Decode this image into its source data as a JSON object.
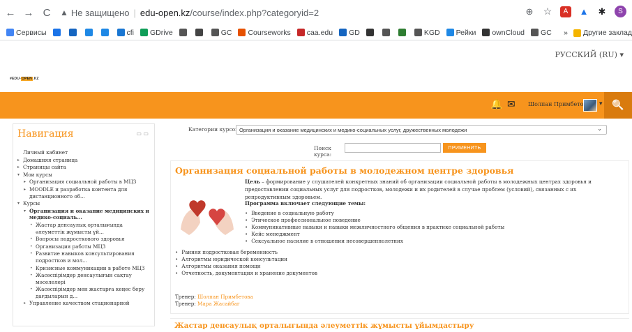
{
  "browser": {
    "back": "←",
    "forward": "→",
    "reload": "C",
    "warning_icon": "▲",
    "not_secure": "Не защищено",
    "url_domain": "edu-open.kz",
    "url_path": "/course/index.php?categoryid=2",
    "extensions": [
      "zoom-icon",
      "star-icon",
      "adobe-icon",
      "drive-icon",
      "puzzle-icon",
      "profile-avatar"
    ],
    "profile_letter": "S"
  },
  "bookmarks": {
    "items": [
      {
        "label": "Сервисы",
        "color": "#4285f4"
      },
      {
        "label": "",
        "color": "#1a73e8"
      },
      {
        "label": "",
        "color": "#1565c0"
      },
      {
        "label": "",
        "color": "#1e88e5"
      },
      {
        "label": "",
        "color": "#1e88e5"
      },
      {
        "label": "cfi",
        "color": "#1976d2"
      },
      {
        "label": "GDrive",
        "color": "#0f9d58"
      },
      {
        "label": "",
        "color": "#555555"
      },
      {
        "label": "",
        "color": "#444444"
      },
      {
        "label": "GC",
        "color": "#555555"
      },
      {
        "label": "Courseworks",
        "color": "#e65100"
      },
      {
        "label": "caa.edu",
        "color": "#c62828"
      },
      {
        "label": "GD",
        "color": "#1565c0"
      },
      {
        "label": "",
        "color": "#333333"
      },
      {
        "label": "",
        "color": "#555555"
      },
      {
        "label": "",
        "color": "#2e7d32"
      },
      {
        "label": "KGD",
        "color": "#555555"
      },
      {
        "label": "Рейки",
        "color": "#1e88e5"
      },
      {
        "label": "ownCloud",
        "color": "#333333"
      },
      {
        "label": "GC",
        "color": "#555555"
      }
    ],
    "more": "»",
    "other": "Другие заклад"
  },
  "header": {
    "language": "РУССКИЙ (RU) ▾",
    "logo_prefix": "#EDU-",
    "logo_highlight": "OPEN",
    "logo_suffix": ".KZ"
  },
  "topbar": {
    "bell_icon": "🔔",
    "mail_icon": "✉",
    "user_name": "Шолпан Примбетова",
    "caret": "▾",
    "search_icon": "🔍"
  },
  "navigation": {
    "title": "Навигация",
    "title_icons": "▭ ▭",
    "items": [
      {
        "marker": "",
        "indent": 1,
        "bold": false,
        "label": "Личный кабинет"
      },
      {
        "marker": "▸",
        "indent": 1,
        "bold": false,
        "label": "Домашняя страница"
      },
      {
        "marker": "▸",
        "indent": 1,
        "bold": false,
        "label": "Страницы сайта"
      },
      {
        "marker": "▾",
        "indent": 1,
        "bold": false,
        "label": "Мои курсы"
      },
      {
        "marker": "▸",
        "indent": 2,
        "bold": false,
        "label": "Организация социальной работы в МЦЗ"
      },
      {
        "marker": "▸",
        "indent": 2,
        "bold": false,
        "label": "MOODLE и разработка контента для дистанционного об..."
      },
      {
        "marker": "▾",
        "indent": 1,
        "bold": false,
        "label": "Курсы"
      },
      {
        "marker": "▾",
        "indent": 2,
        "bold": true,
        "label": "Организация и оказание медицинских и медико-социаль..."
      },
      {
        "marker": "•",
        "indent": 3,
        "bold": false,
        "label": "Жастар денсаулық орталығында әлеуметтік жұмысты ұй..."
      },
      {
        "marker": "•",
        "indent": 3,
        "bold": false,
        "label": "Вопросы подросткового здоровья"
      },
      {
        "marker": "•",
        "indent": 3,
        "bold": false,
        "label": "Организация работы МЦЗ"
      },
      {
        "marker": "•",
        "indent": 3,
        "bold": false,
        "label": "Развитие навыков консультирования подростков и мол..."
      },
      {
        "marker": "•",
        "indent": 3,
        "bold": false,
        "label": "Кризисные коммуникации в работе МЦЗ"
      },
      {
        "marker": "•",
        "indent": 3,
        "bold": false,
        "label": "Жасөспірімдер денсаулығын сақтау мәселелері"
      },
      {
        "marker": "•",
        "indent": 3,
        "bold": false,
        "label": "Жасөспірімдер мен жастарға кеңес беру дағдыларын д..."
      },
      {
        "marker": "▸",
        "indent": 2,
        "bold": false,
        "label": "Управление качеством стационарной"
      }
    ]
  },
  "filter": {
    "label": "Категории курсов:",
    "selected": "Организация и оказание медицинских и медико-социальных услуг, дружественных молодежи",
    "chevron": "⌄"
  },
  "course_search": {
    "label": "Поиск курса:",
    "value": "",
    "button": "ПРИМЕНИТЬ"
  },
  "course": {
    "title": "Организация социальной работы в молодежном центре здоровья",
    "summary_bold": "Цель",
    "summary_rest": " – формирование у слушателей конкретных знаний об организации социальной работы в молодежных центрах здоровья и предоставлении социальных услуг для подростков, молодежи и их родителей в случае проблем (условий), связанных с их репродуктивным здоровьем.",
    "program_heading": "Программа включает следующие темы:",
    "topics_a": [
      "Введение в социальную работу",
      "Этическое профессиональное поведение",
      "Коммуникативные навыки и навыки межличностного общения в практике социальной работы",
      "Кейс менеджмент",
      "Сексуальное насилие в отношении несовершеннолетних"
    ],
    "topics_b": [
      "Ранняя подростковая беременность",
      "Алгоритмы юридической консультации",
      "Алгоритмы оказания помощи",
      "Отчетность, документация и хранение документов"
    ],
    "trainer_label": "Тренер:",
    "trainer1": "Шолпан Примбетова",
    "trainer2": "Мара Жасайбаг"
  },
  "next_course": {
    "title": "Жастар денсаулық орталығында әлеуметтік жұмысты ұйымдастыру"
  }
}
